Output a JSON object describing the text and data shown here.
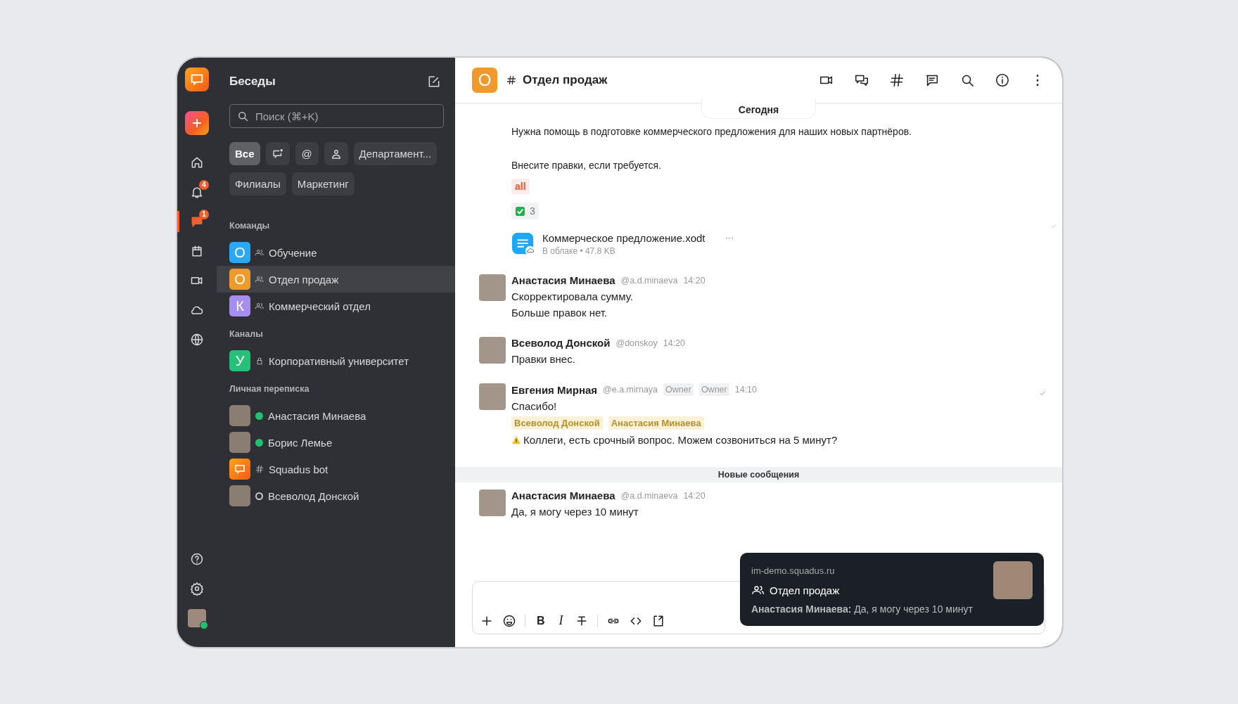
{
  "rail": {
    "top": [
      {
        "kind": "home",
        "selected": false
      },
      {
        "kind": "bell",
        "selected": false,
        "badge": "4"
      },
      {
        "kind": "chat",
        "selected": true,
        "badge": "1"
      },
      {
        "kind": "calendar",
        "selected": false
      },
      {
        "kind": "video",
        "selected": false
      },
      {
        "kind": "cloud",
        "selected": false
      },
      {
        "kind": "globe",
        "selected": false
      }
    ],
    "bottom": [
      {
        "kind": "help"
      },
      {
        "kind": "settings"
      }
    ],
    "user": {
      "online": true
    }
  },
  "sidebar": {
    "title": "Беседы",
    "search": {
      "placeholder": "Поиск (⌘+K)"
    },
    "filters": [
      {
        "kind": "text",
        "label": "Все",
        "selected": true
      },
      {
        "kind": "chat",
        "selected": false
      },
      {
        "kind": "text",
        "label": "@",
        "selected": false
      },
      {
        "kind": "person",
        "selected": false
      },
      {
        "kind": "text",
        "label": "Департамент...",
        "selected": false
      },
      {
        "kind": "text",
        "label": "Филиалы",
        "selected": false
      },
      {
        "kind": "text",
        "label": "Маркетинг",
        "selected": false
      }
    ],
    "sections": [
      {
        "title": "Команды",
        "items": [
          {
            "kind": "team",
            "avatar": {
              "kind": "letter",
              "letter": "О",
              "color": "#2aa8f2"
            },
            "name": "Обучение",
            "selected": false
          },
          {
            "kind": "team",
            "avatar": {
              "kind": "letter",
              "letter": "О",
              "color": "#ef9a2c"
            },
            "name": "Отдел продаж",
            "selected": true
          },
          {
            "kind": "team",
            "avatar": {
              "kind": "letter",
              "letter": "К",
              "color": "#a48ef0"
            },
            "name": "Коммерческий отдел",
            "selected": false
          }
        ]
      },
      {
        "title": "Каналы",
        "items": [
          {
            "kind": "channel",
            "avatar": {
              "kind": "letter",
              "letter": "У",
              "color": "#27c07a"
            },
            "name": "Корпоративный университет",
            "selected": false
          }
        ]
      },
      {
        "title": "Личная переписка",
        "items": [
          {
            "kind": "online",
            "avatar": {
              "kind": "photo"
            },
            "name": "Анастасия Минаева",
            "selected": false
          },
          {
            "kind": "online",
            "avatar": {
              "kind": "photo"
            },
            "name": "Борис Лемье",
            "selected": false
          },
          {
            "kind": "bot",
            "avatar": {
              "kind": "logo"
            },
            "name": "Squadus bot",
            "selected": false
          },
          {
            "kind": "offline",
            "avatar": {
              "kind": "photo"
            },
            "name": "Всеволод Донской",
            "selected": false
          }
        ]
      }
    ]
  },
  "chat": {
    "header": {
      "letter": "О",
      "color": "#ef9a2c",
      "title": "Отдел продаж",
      "actions": [
        {
          "kind": "video"
        },
        {
          "kind": "chats"
        },
        {
          "kind": "hash"
        },
        {
          "kind": "message"
        },
        {
          "kind": "search"
        },
        {
          "kind": "info"
        },
        {
          "kind": "more"
        }
      ]
    },
    "date": "Сегодня",
    "timeline": [
      {
        "kind": "continuation",
        "paragraphs": [
          "Нужна помощь в подготовке коммерческого предложения для наших новых партнёров.",
          "Внесите правки, если требуется."
        ],
        "mention": "all",
        "reaction": {
          "count": "3"
        },
        "file": {
          "name": "Коммерческое предложение.xodt",
          "meta": "В облаке • 47.8 KB",
          "more": "···"
        },
        "read": true
      },
      {
        "kind": "message",
        "author": "Анастасия Минаева",
        "handle": "@a.d.minaeva",
        "time": "14:20",
        "lines": [
          "Скорректировала сумму.",
          "Больше правок нет."
        ],
        "read": false
      },
      {
        "kind": "message",
        "author": "Всеволод Донской",
        "handle": "@donskoy",
        "time": "14:20",
        "lines": [
          "Правки внес."
        ],
        "read": false
      },
      {
        "kind": "message",
        "author": "Евгения Мирная",
        "handle": "@e.a.mirnaya",
        "roles": [
          "Owner",
          "Owner"
        ],
        "time": "14:10",
        "lines": [
          "Спасибо!"
        ],
        "mentions": [
          "Всеволод Донской",
          "Анастасия Минаева"
        ],
        "alert": "Коллеги, есть срочный вопрос. Можем созвониться на 5 минут?",
        "read": true
      },
      {
        "kind": "new-divider",
        "label": "Новые сообщения"
      },
      {
        "kind": "message",
        "author": "Анастасия Минаева",
        "handle": "@a.d.minaeva",
        "time": "14:20",
        "lines": [
          "Да, я могу через 10 минут"
        ],
        "read": false
      }
    ],
    "composer": {
      "tools": [
        {
          "kind": "plus"
        },
        {
          "kind": "emoji"
        },
        {
          "kind": "sep"
        },
        {
          "kind": "bold",
          "label": "B"
        },
        {
          "kind": "italic",
          "label": "I"
        },
        {
          "kind": "strike"
        },
        {
          "kind": "sep"
        },
        {
          "kind": "link"
        },
        {
          "kind": "code"
        },
        {
          "kind": "embed"
        }
      ]
    }
  },
  "notification": {
    "site": "im-demo.squadus.ru",
    "title": "Отдел продаж",
    "text": "**Анастасия Минаева:** Да, я могу через 10 минут"
  }
}
